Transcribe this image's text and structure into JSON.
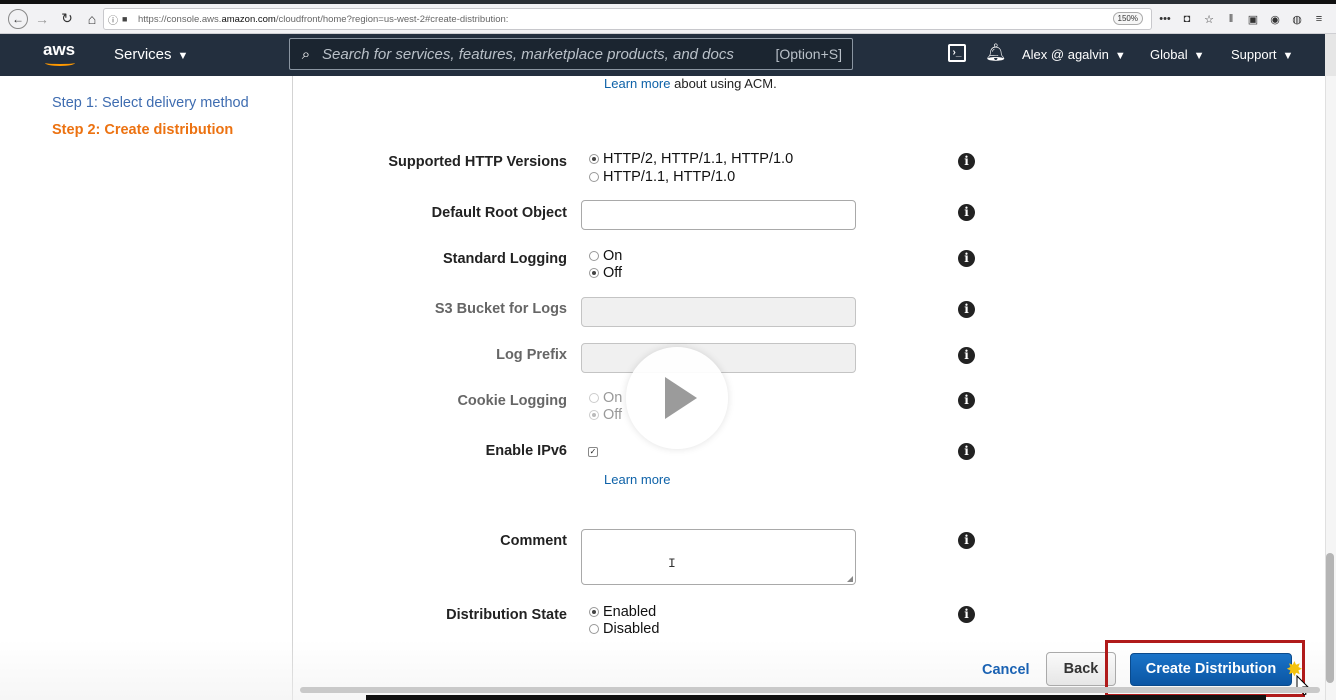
{
  "browser": {
    "url_prefix": "https://console.aws.",
    "url_domain": "amazon.com",
    "url_suffix": "/cloudfront/home?region=us-west-2#create-distribution:",
    "zoom": "150%"
  },
  "aws_nav": {
    "logo": "aws",
    "services_label": "Services",
    "search_placeholder": "Search for services, features, marketplace products, and docs",
    "search_shortcut": "[Option+S]",
    "user_label": "Alex @ agalvin",
    "region_label": "Global",
    "support_label": "Support"
  },
  "sidebar": {
    "steps": [
      {
        "label": "Step 1: Select delivery method"
      },
      {
        "label": "Step 2: Create distribution"
      }
    ]
  },
  "form": {
    "acm_learn_more": "Learn more",
    "acm_note": "about using ACM.",
    "http_versions": {
      "label": "Supported HTTP Versions",
      "options": [
        "HTTP/2, HTTP/1.1, HTTP/1.0",
        "HTTP/1.1, HTTP/1.0"
      ],
      "selected": "HTTP/2, HTTP/1.1, HTTP/1.0"
    },
    "default_root_object": {
      "label": "Default Root Object",
      "value": ""
    },
    "standard_logging": {
      "label": "Standard Logging",
      "options": [
        "On",
        "Off"
      ],
      "selected": "Off"
    },
    "s3_bucket": {
      "label": "S3 Bucket for Logs",
      "value": ""
    },
    "log_prefix": {
      "label": "Log Prefix",
      "value": ""
    },
    "cookie_logging": {
      "label": "Cookie Logging",
      "options": [
        "On",
        "Off"
      ],
      "selected": "Off"
    },
    "ipv6": {
      "label": "Enable IPv6",
      "checked": true,
      "learn_more": "Learn more"
    },
    "comment": {
      "label": "Comment",
      "value": ""
    },
    "distribution_state": {
      "label": "Distribution State",
      "options": [
        "Enabled",
        "Disabled"
      ],
      "selected": "Enabled"
    }
  },
  "footer": {
    "cancel": "Cancel",
    "back": "Back",
    "create": "Create Distribution"
  },
  "colors": {
    "nav_bg": "#232f3e",
    "step_active": "#ec7211",
    "step_link": "#3e6cb0",
    "primary_button": "#0b56a4",
    "highlight": "#b01a1a"
  }
}
